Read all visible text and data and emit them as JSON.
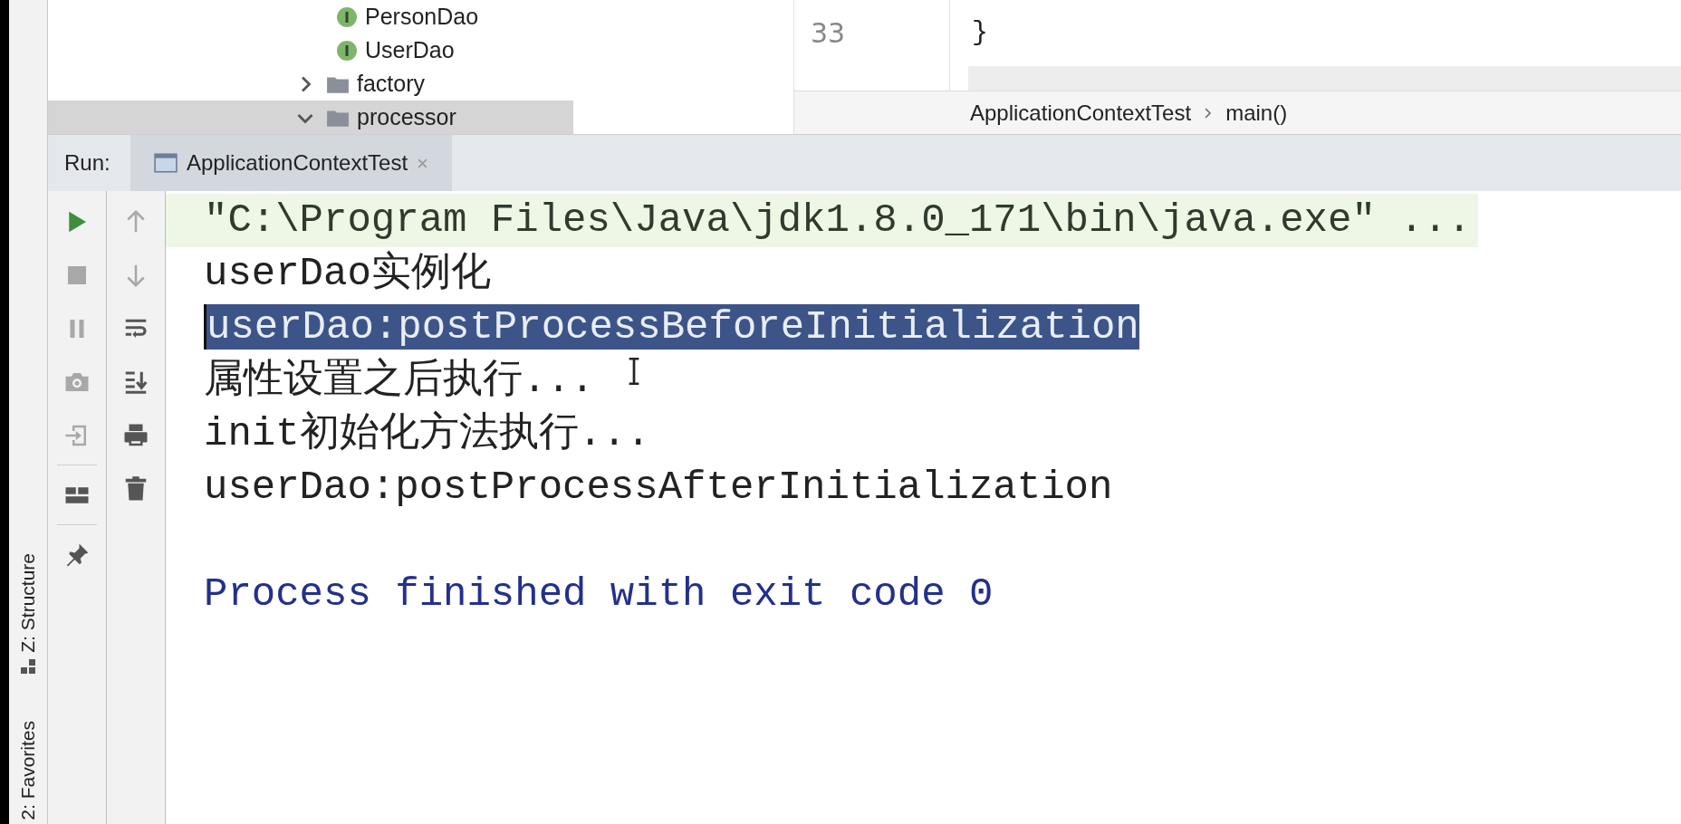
{
  "side_stripe": {
    "items": [
      {
        "label": "Z: Structure",
        "kind": "structure"
      },
      {
        "label": "2: Favorites",
        "kind": "favorites"
      }
    ]
  },
  "project_tree": {
    "items": [
      {
        "children": [
          {
            "label": "PersonDao",
            "kind": "interface",
            "selected": false
          },
          {
            "label": "UserDao",
            "kind": "interface",
            "selected": false
          }
        ]
      },
      {
        "label": "factory",
        "kind": "folder",
        "expanded": false,
        "selected": false
      },
      {
        "label": "processor",
        "kind": "folder",
        "expanded": true,
        "selected": true
      }
    ]
  },
  "editor": {
    "lines": [
      {
        "number": "33",
        "code": "}"
      }
    ],
    "breadcrumbs": [
      "ApplicationContextTest",
      "main()"
    ]
  },
  "run_panel": {
    "label": "Run:",
    "tabs": [
      {
        "label": "ApplicationContextTest",
        "selected": true
      }
    ],
    "toolbar_left": [
      {
        "kind": "run",
        "disabled": false
      },
      {
        "kind": "stop",
        "disabled": true
      },
      {
        "kind": "pause",
        "disabled": true
      },
      {
        "kind": "camera",
        "disabled": true
      },
      {
        "kind": "import",
        "disabled": true
      },
      {
        "kind": "separator"
      },
      {
        "kind": "layout",
        "disabled": false
      },
      {
        "kind": "separator"
      },
      {
        "kind": "pin",
        "disabled": false
      }
    ],
    "toolbar_right": [
      {
        "kind": "up",
        "disabled": true
      },
      {
        "kind": "down",
        "disabled": true
      },
      {
        "kind": "wrap",
        "disabled": false
      },
      {
        "kind": "scroll-end",
        "disabled": false
      },
      {
        "kind": "print",
        "disabled": false
      },
      {
        "kind": "trash",
        "disabled": false
      }
    ],
    "console": [
      {
        "text": "\"C:\\Program Files\\Java\\jdk1.8.0_171\\bin\\java.exe\" ...",
        "kind": "command",
        "selected": false
      },
      {
        "text": "userDao实例化",
        "kind": "output",
        "selected": false
      },
      {
        "text": "userDao:postProcessBeforeInitialization",
        "kind": "output",
        "selected": true
      },
      {
        "text": "属性设置之后执行...",
        "kind": "output",
        "selected": false
      },
      {
        "text": "init初始化方法执行...",
        "kind": "output",
        "selected": false
      },
      {
        "text": "userDao:postProcessAfterInitialization",
        "kind": "output",
        "selected": false
      },
      {
        "text": "Process finished with exit code 0",
        "kind": "system",
        "selected": false
      }
    ]
  }
}
